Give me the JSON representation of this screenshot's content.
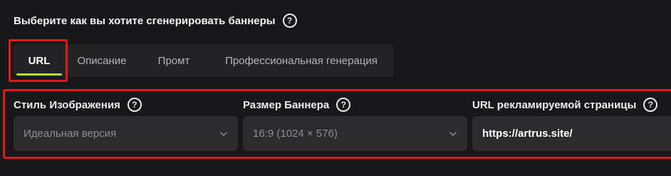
{
  "heading": {
    "text": "Выберите как вы хотите сгенерировать баннеры",
    "help_glyph": "?"
  },
  "tabs": [
    {
      "label": "URL",
      "active": true
    },
    {
      "label": "Описание",
      "active": false
    },
    {
      "label": "Промт",
      "active": false
    },
    {
      "label": "Профессиональная генерация",
      "active": false
    }
  ],
  "fields": {
    "image_style": {
      "label": "Стиль Изображения",
      "help_glyph": "?",
      "value": "Идеальная версия"
    },
    "banner_size": {
      "label": "Размер Баннера",
      "help_glyph": "?",
      "value": "16:9 (1024 × 576)"
    },
    "page_url": {
      "label": "URL рекламируемой страницы",
      "help_glyph": "?",
      "value": "https://artrus.site/"
    }
  },
  "colors": {
    "background": "#18181a",
    "tab_bar": "#232326",
    "control": "#2c2c2f",
    "accent_underline": "#b4e03a",
    "highlight_box": "#e01818"
  },
  "icons": {
    "help": "question-circle-icon",
    "dropdown": "chevron-down-icon"
  }
}
